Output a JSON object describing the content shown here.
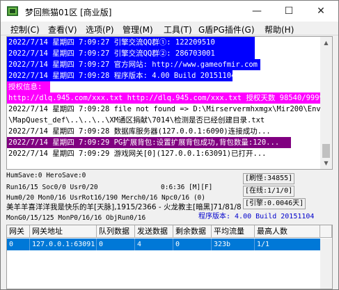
{
  "window": {
    "title": "梦回熊猫01区 [商业版]",
    "min_glyph": "—",
    "max_glyph": "☐",
    "close_glyph": "✕"
  },
  "menu": [
    {
      "label": "控制(C)"
    },
    {
      "label": "查看(V)"
    },
    {
      "label": "选项(P)"
    },
    {
      "label": "管理(M)"
    },
    {
      "label": "工具(T)"
    },
    {
      "label": "G盾PG插件(G)"
    },
    {
      "label": "帮助(H)"
    }
  ],
  "log": {
    "lines": [
      {
        "text": "2022/7/14 星期四 7:09:27 引擎交流QQ群①: 122209510",
        "style": "bg-blue"
      },
      {
        "text": "2022/7/14 星期四 7:09:27 引擎交流QQ群②: 286703001",
        "style": "bg-blue"
      },
      {
        "text": "2022/7/14 星期四 7:09:27 官方网站: http://www.gameofmir.com",
        "style": "bg-blue"
      },
      {
        "text": "2022/7/14 星期四 7:09:28 程序版本: 4.00 Build 20151104",
        "style": "bg-blue"
      },
      {
        "text": "授权信息:",
        "style": "bg-magenta"
      },
      {
        "text": "http://dlq.945.com/xxx.txt http://dlq.945.com/xxx.txt 授权天数 98540/99999",
        "style": "bg-magenta"
      },
      {
        "text": "2022/7/14 星期四 7:09:28 file not found => D:\\Mirservermhxmgx\\Mir200\\Envir",
        "style": "plain"
      },
      {
        "text": "\\MapQuest_def\\..\\..\\..\\XM通区捐献\\7014\\检测是否已经创建目录.txt",
        "style": "plain"
      },
      {
        "text": "2022/7/14 星期四 7:09:28 数据库服务器(127.0.0.1:6090)连接成功...",
        "style": "plain"
      },
      {
        "text": "2022/7/14 星期四 7:09:29 PG扩展背包:设置扩展背包成功,背包数量:120...",
        "style": "bg-purple"
      },
      {
        "text": "2022/7/14 星期四 7:09:29 游戏网关[0](127.0.0.1:63091)已打开...",
        "style": "plain"
      }
    ],
    "scroll_up_glyph": "▲",
    "scroll_down_glyph": "▼"
  },
  "status": {
    "human_save": "HumSave:0 HeroSave:0",
    "run_line": "Run16/15 Soc0/0 Usr0/20",
    "timer": "0:6:36 [M][F]",
    "hum_line": "Hum0/20 Mon0/16 UsrRot16/190 Merch0/16 Npc0/16 (0)",
    "player_line": "美羊羊喜洋洋我是快乐的羊[天脉],1915/2366 - 火龙教主[暗黑]71/81/8",
    "mon_line": "MonG0/15/125 MonP0/16/16 ObjRun0/16",
    "refresh": "[刷怪:34855]",
    "online": "[在线:1/1/0]",
    "cited": "[引擎:0.0046天]",
    "version": "程序版本: 4.00 Build 20151104"
  },
  "table": {
    "headers": [
      "网关",
      "网关地址",
      "队列数据",
      "发送数据",
      "剩余数据",
      "平均流量",
      "最高人数"
    ],
    "rows": [
      [
        "0",
        "127.0.0.1:63091",
        "0",
        "4",
        "0",
        "323b",
        "1/1"
      ]
    ]
  },
  "colors": {
    "log_blue": "#0000ff",
    "log_magenta": "#ff00ff",
    "log_purple": "#800080",
    "selection": "#0078d7",
    "version_text": "#0000cc"
  }
}
